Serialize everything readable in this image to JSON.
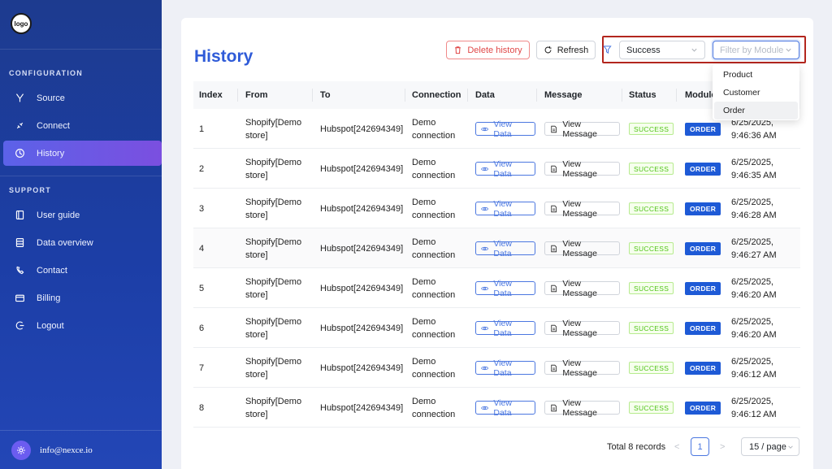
{
  "sidebar": {
    "logo_text": "logo",
    "config_heading": "CONFIGURATION",
    "support_heading": "SUPPORT",
    "config_items": [
      {
        "label": "Source",
        "icon": "source-icon"
      },
      {
        "label": "Connect",
        "icon": "connect-icon"
      },
      {
        "label": "History",
        "icon": "history-icon",
        "active": true
      }
    ],
    "support_items": [
      {
        "label": "User guide",
        "icon": "book-icon"
      },
      {
        "label": "Data overview",
        "icon": "database-icon"
      },
      {
        "label": "Contact",
        "icon": "contact-icon"
      },
      {
        "label": "Billing",
        "icon": "billing-icon"
      },
      {
        "label": "Logout",
        "icon": "logout-icon"
      }
    ],
    "user_email": "info@nexce.io"
  },
  "header": {
    "title": "History",
    "delete_label": "Delete history",
    "refresh_label": "Refresh",
    "status_filter_value": "Success",
    "module_filter_placeholder": "Filter by Module",
    "module_options": [
      "Product",
      "Customer",
      "Order"
    ]
  },
  "table": {
    "columns": [
      "Index",
      "From",
      "To",
      "Connection",
      "Data",
      "Message",
      "Status",
      "Module",
      ""
    ],
    "rows": [
      {
        "index": "1",
        "from_1": "Shopify[Demo",
        "from_2": "store]",
        "to": "Hubspot[242694349]",
        "conn_1": "Demo",
        "conn_2": "connection",
        "data": "View Data",
        "message": "View Message",
        "status": "SUCCESS",
        "module": "ORDER",
        "date": "6/25/2025,",
        "time": "9:46:36 AM"
      },
      {
        "index": "2",
        "from_1": "Shopify[Demo",
        "from_2": "store]",
        "to": "Hubspot[242694349]",
        "conn_1": "Demo",
        "conn_2": "connection",
        "data": "View Data",
        "message": "View Message",
        "status": "SUCCESS",
        "module": "ORDER",
        "date": "6/25/2025,",
        "time": "9:46:35 AM"
      },
      {
        "index": "3",
        "from_1": "Shopify[Demo",
        "from_2": "store]",
        "to": "Hubspot[242694349]",
        "conn_1": "Demo",
        "conn_2": "connection",
        "data": "View Data",
        "message": "View Message",
        "status": "SUCCESS",
        "module": "ORDER",
        "date": "6/25/2025,",
        "time": "9:46:28 AM"
      },
      {
        "index": "4",
        "from_1": "Shopify[Demo",
        "from_2": "store]",
        "to": "Hubspot[242694349]",
        "conn_1": "Demo",
        "conn_2": "connection",
        "data": "View Data",
        "message": "View Message",
        "status": "SUCCESS",
        "module": "ORDER",
        "date": "6/25/2025,",
        "time": "9:46:27 AM"
      },
      {
        "index": "5",
        "from_1": "Shopify[Demo",
        "from_2": "store]",
        "to": "Hubspot[242694349]",
        "conn_1": "Demo",
        "conn_2": "connection",
        "data": "View Data",
        "message": "View Message",
        "status": "SUCCESS",
        "module": "ORDER",
        "date": "6/25/2025,",
        "time": "9:46:20 AM"
      },
      {
        "index": "6",
        "from_1": "Shopify[Demo",
        "from_2": "store]",
        "to": "Hubspot[242694349]",
        "conn_1": "Demo",
        "conn_2": "connection",
        "data": "View Data",
        "message": "View Message",
        "status": "SUCCESS",
        "module": "ORDER",
        "date": "6/25/2025,",
        "time": "9:46:20 AM"
      },
      {
        "index": "7",
        "from_1": "Shopify[Demo",
        "from_2": "store]",
        "to": "Hubspot[242694349]",
        "conn_1": "Demo",
        "conn_2": "connection",
        "data": "View Data",
        "message": "View Message",
        "status": "SUCCESS",
        "module": "ORDER",
        "date": "6/25/2025,",
        "time": "9:46:12 AM"
      },
      {
        "index": "8",
        "from_1": "Shopify[Demo",
        "from_2": "store]",
        "to": "Hubspot[242694349]",
        "conn_1": "Demo",
        "conn_2": "connection",
        "data": "View Data",
        "message": "View Message",
        "status": "SUCCESS",
        "module": "ORDER",
        "date": "6/25/2025,",
        "time": "9:46:12 AM"
      }
    ]
  },
  "pagination": {
    "total": "Total 8 records",
    "prev": "<",
    "current_page": "1",
    "next": ">",
    "page_size": "15 / page"
  },
  "colors": {
    "sidebar": "#1d3b8f",
    "accent": "#2f5bd8",
    "active_item": "#6a58e6",
    "highlight_border": "#b3261e",
    "success": "#52c41a",
    "module_badge": "#1e5ad6"
  }
}
